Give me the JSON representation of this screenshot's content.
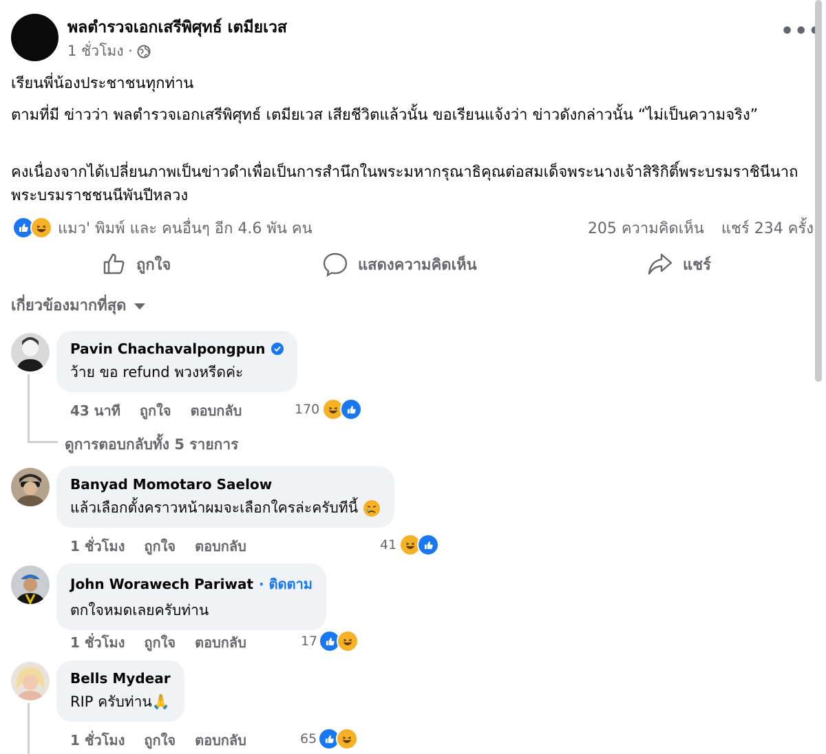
{
  "post": {
    "author": "พลตำรวจเอกเสรีพิศุทธ์ เตมียเวส",
    "time": "1 ชั่วโมง ·",
    "paragraphs": [
      "เรียนพี่น้องประชาชนทุกท่าน",
      "ตามที่มี ข่าวว่า พลตำรวจเอกเสรีพิศุทธ์ เตมียเวส เสียชีวิตแล้วนั้น ขอเรียนแจ้งว่า ข่าวดังกล่าวนั้น “ไม่เป็นความจริง”",
      "คงเนื่องจากได้เปลี่ยนภาพเป็นข่าวดำเพื่อเป็นการสำนึกในพระมหากรุณาธิคุณต่อสมเด็จพระนางเจ้าสิริกิติ์พระบรมราชินีนาถ พระบรมราชชนนีพันปีหลวง"
    ],
    "reactors": "แมว' พิมพ์ และ คนอื่นๆ อีก 4.6 พัน คน",
    "comments_count": "205 ความคิดเห็น",
    "shares_count": "แชร์ 234 ครั้ง"
  },
  "actions": {
    "like": "ถูกใจ",
    "comment": "แสดงความคิดเห็น",
    "share": "แชร์"
  },
  "sort_label": "เกี่ยวข้องมากที่สุด",
  "comments": [
    {
      "name": "Pavin Chachavalpongpun",
      "text": "ว้าย ขอ refund พวงหรีดค่ะ",
      "time": "43 นาที",
      "like": "ถูกใจ",
      "reply": "ตอบกลับ",
      "reactions": "170",
      "view_replies": "ดูการตอบกลับทั้ง 5 รายการ"
    },
    {
      "name": "Banyad Momotaro Saelow",
      "text": "แล้วเลือกตั้งคราวหน้าผมจะเลือกใครล่ะครับทีนี้",
      "time": "1 ชั่วโมง",
      "like": "ถูกใจ",
      "reply": "ตอบกลับ",
      "reactions": "41"
    },
    {
      "name": "John Worawech Pariwat",
      "follow": "· ติดตาม",
      "text": "ตกใจหมดเลยครับท่าน",
      "time": "1 ชั่วโมง",
      "like": "ถูกใจ",
      "reply": "ตอบกลับ",
      "reactions": "17"
    },
    {
      "name": "Bells Mydear",
      "text": "RIP ครับท่าน🙏",
      "time": "1 ชั่วโมง",
      "like": "ถูกใจ",
      "reply": "ตอบกลับ",
      "reactions": "65"
    }
  ],
  "colors": {
    "link_blue": "#1877f2",
    "haha_yellow": "#f7b125",
    "secondary_text": "#65676b",
    "bubble_bg": "#f0f2f5"
  },
  "icons": [
    "globe-icon",
    "more-icon",
    "like-icon",
    "comment-icon",
    "share-icon",
    "caret-down-icon",
    "verified-icon",
    "like-reaction-icon",
    "haha-reaction-icon",
    "crying-emoji-icon"
  ]
}
